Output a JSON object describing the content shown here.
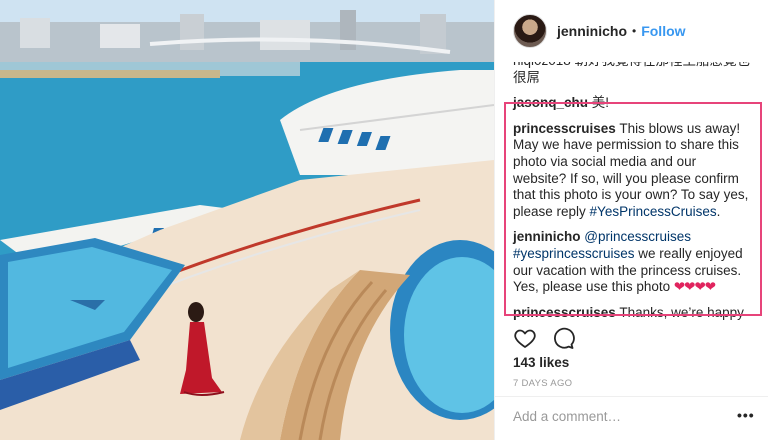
{
  "post": {
    "username": "jenninicho",
    "separator": "•",
    "follow_label": "Follow"
  },
  "comments": {
    "partial_top": "nlqi0z018 朝好我覺得在那裡坐船感覺也很屌",
    "jason": {
      "author": "jasonq_chu",
      "text": " 美!"
    },
    "princess1": {
      "author": "princesscruises",
      "text": " This blows us away! May we have permission to share this photo via social media and our website? If so, will you please confirm that this photo is your own? To say yes, please reply ",
      "hashtag": "#YesPrincessCruises",
      "end": "."
    },
    "jenni": {
      "author": "jenninicho",
      "mention": "@princesscruises",
      "hashtag": "#yesprincesscruises",
      "text": " we really enjoyed our vacation with the princess cruises. Yes, please use this photo ",
      "hearts": "❤❤❤❤"
    },
    "princess2": {
      "author": "princesscruises",
      "text": " Thanks, we’re happy to hear you enjoyed cruising with us! Hope to see you on board again soon. "
    }
  },
  "actions": {
    "like_icon": "heart-outline-icon",
    "comment_icon": "comment-bubble-icon"
  },
  "likes": "143 likes",
  "timestamp": "7 DAYS AGO",
  "add_comment": {
    "placeholder": "Add a comment…",
    "more_label": "•••"
  },
  "colors": {
    "link": "#003569",
    "follow": "#3897f0",
    "highlight": "#e7447a"
  }
}
